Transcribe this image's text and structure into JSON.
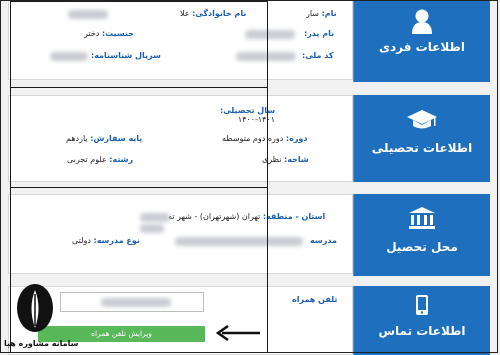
{
  "tiles": {
    "personal": "اطلاعات فردی",
    "education": "اطلاعات تحصیلی",
    "place": "محل تحصیل",
    "contact": "اطلاعات تماس"
  },
  "personal": {
    "family_label": "نام خانوادگی:",
    "family_value": "علا",
    "name_label": "نام:",
    "name_value": "سار",
    "gender_label": "جنسیت:",
    "gender_value": "دختر",
    "father_label": "نام پدر:",
    "serial_label": "سریال شناسنامه:",
    "national_label": "کد ملی:"
  },
  "education": {
    "year_label": "سال تحصیلی:",
    "year_value": "۱۴۰۰-۱۴۰۱",
    "period_label": "دوره:",
    "period_value": "دوره دوم متوسطه",
    "grade_label": "پایه سفارش:",
    "grade_value": "یازدهم",
    "branch_label": "شاخه:",
    "branch_value": "نظری",
    "field_label": "رشته:",
    "field_value": "علوم تجربی"
  },
  "place": {
    "region_label": "استان - منطقه:",
    "region_value": "تهران (شهرتهران) - شهر ته",
    "school_label": "مدرسه",
    "school_type_label": "نوع مدرسه:",
    "school_type_value": "دولتی"
  },
  "contact": {
    "phone_label": "تلفن همراه",
    "edit_button": "ویرایش تلفن همراه"
  },
  "watermark": {
    "text": "سامانه مشاوره هپا"
  },
  "colors": {
    "tile_blue": "#1f6fbf",
    "label_blue": "#1c5fb0",
    "button_green": "#59b859"
  }
}
